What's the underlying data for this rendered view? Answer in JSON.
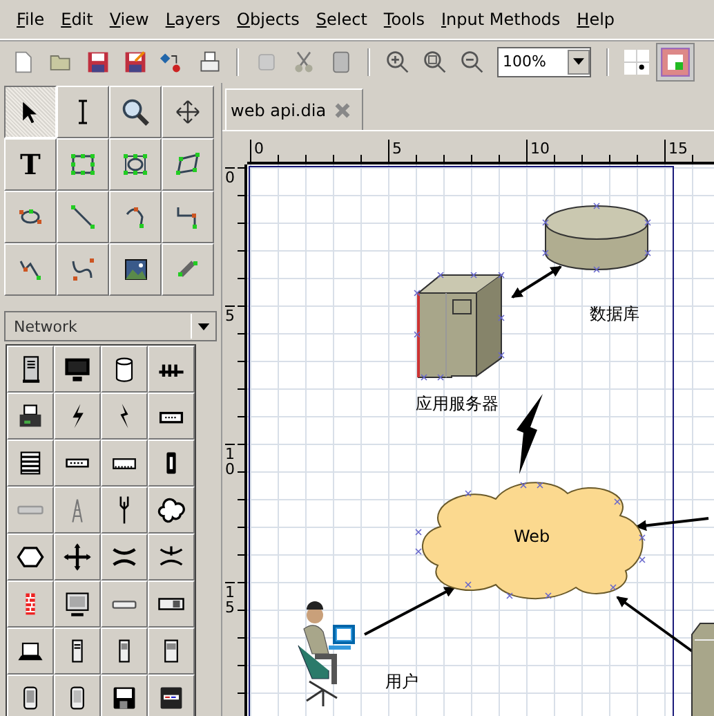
{
  "menu": [
    "File",
    "Edit",
    "View",
    "Layers",
    "Objects",
    "Select",
    "Tools",
    "Input Methods",
    "Help"
  ],
  "toolbar": {
    "zoom_value": "100%"
  },
  "tools": [
    {
      "kind": "pointer",
      "selected": true
    },
    {
      "kind": "text-edit",
      "selected": false
    },
    {
      "kind": "magnify",
      "selected": false
    },
    {
      "kind": "scroll",
      "selected": false
    },
    {
      "kind": "text",
      "glyph": "T",
      "selected": false
    },
    {
      "kind": "box",
      "selected": false
    },
    {
      "kind": "ellipse",
      "selected": false
    },
    {
      "kind": "polygon",
      "selected": false
    },
    {
      "kind": "beziergon",
      "selected": false
    },
    {
      "kind": "line",
      "selected": false
    },
    {
      "kind": "arc",
      "selected": false
    },
    {
      "kind": "zigzag",
      "selected": false
    },
    {
      "kind": "polyline",
      "selected": false
    },
    {
      "kind": "bezier",
      "selected": false
    },
    {
      "kind": "image",
      "selected": false
    },
    {
      "kind": "outline",
      "selected": false
    }
  ],
  "sheet": {
    "value": "Network"
  },
  "tab": {
    "label": "web api.dia"
  },
  "rulers": {
    "horizontal": [
      "0",
      "5",
      "10",
      "15"
    ],
    "vertical": [
      "0",
      "5",
      "10",
      "15"
    ]
  },
  "diagram": {
    "nodes": [
      {
        "kind": "database",
        "label": "数据库"
      },
      {
        "kind": "server",
        "label": "应用服务器"
      },
      {
        "kind": "cloud",
        "label": "Web"
      },
      {
        "kind": "user",
        "label": "用户"
      },
      {
        "kind": "server-partial"
      }
    ]
  }
}
